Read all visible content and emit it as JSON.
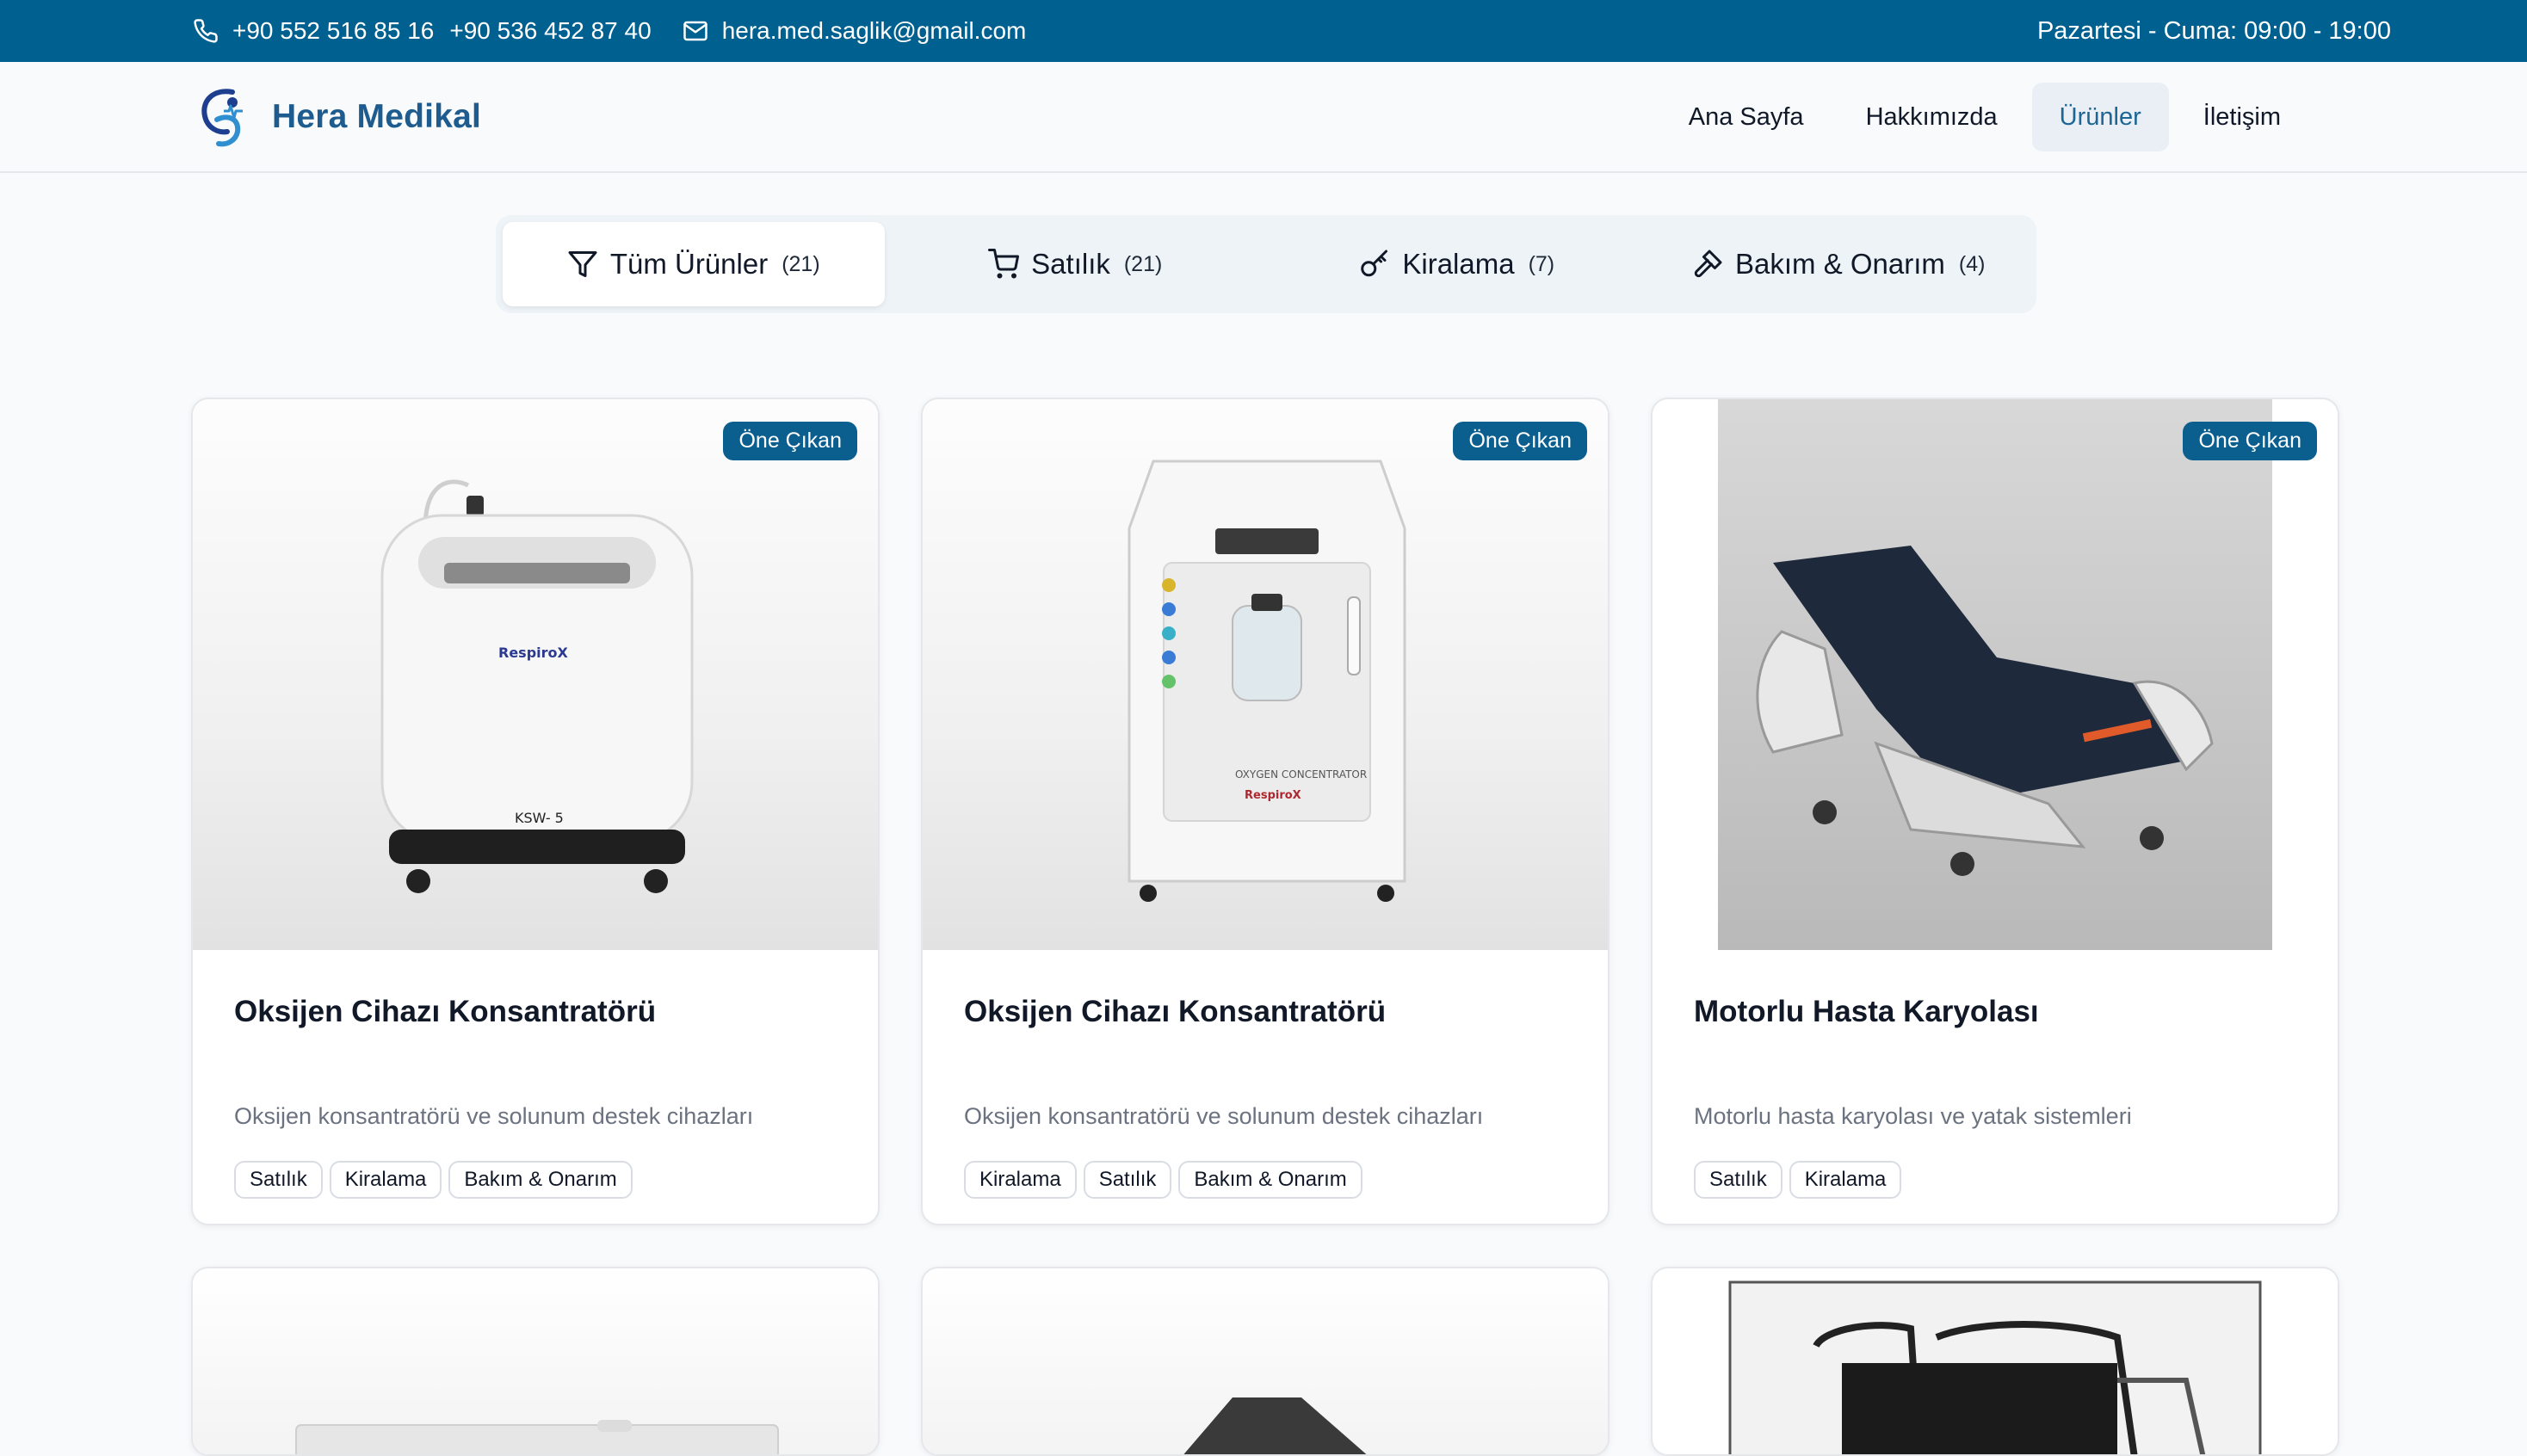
{
  "topbar": {
    "phone1": "+90 552 516 85 16",
    "phone2": "+90 536 452 87 40",
    "email": "hera.med.saglik@gmail.com",
    "hours": "Pazartesi - Cuma: 09:00 - 19:00"
  },
  "brand": {
    "name": "Hera Medikal"
  },
  "nav": [
    {
      "label": "Ana Sayfa",
      "active": false
    },
    {
      "label": "Hakkımızda",
      "active": false
    },
    {
      "label": "Ürünler",
      "active": true
    },
    {
      "label": "İletişim",
      "active": false
    }
  ],
  "filters": [
    {
      "label": "Tüm Ürünler",
      "count": "(21)",
      "icon": "filter-icon",
      "active": true
    },
    {
      "label": "Satılık",
      "count": "(21)",
      "icon": "cart-icon",
      "active": false
    },
    {
      "label": "Kiralama",
      "count": "(7)",
      "icon": "key-icon",
      "active": false
    },
    {
      "label": "Bakım & Onarım",
      "count": "(4)",
      "icon": "hammer-icon",
      "active": false
    }
  ],
  "products": [
    {
      "badge": "Öne Çıkan",
      "title": "Oksijen Cihazı Konsantratörü",
      "description": "Oksijen konsantratörü ve solunum destek cihazları",
      "tags": [
        "Satılık",
        "Kiralama",
        "Bakım & Onarım"
      ],
      "image": "oxygen-concentrator-round",
      "device_label": "RespiroX",
      "model": "KSW- 5"
    },
    {
      "badge": "Öne Çıkan",
      "title": "Oksijen Cihazı Konsantratörü",
      "description": "Oksijen konsantratörü ve solunum destek cihazları",
      "tags": [
        "Kiralama",
        "Satılık",
        "Bakım & Onarım"
      ],
      "image": "oxygen-concentrator-tall",
      "device_label": "RespiroX",
      "device_text": "OXYGEN CONCENTRATOR"
    },
    {
      "badge": "Öne Çıkan",
      "title": "Motorlu Hasta Karyolası",
      "description": "Motorlu hasta karyolası ve yatak sistemleri",
      "tags": [
        "Satılık",
        "Kiralama"
      ],
      "image": "hospital-bed"
    }
  ],
  "colors": {
    "topbar": "#00608f",
    "brand": "#1e5c8f",
    "badge": "#0a5f8f",
    "active_nav_bg": "#e9eff5"
  }
}
